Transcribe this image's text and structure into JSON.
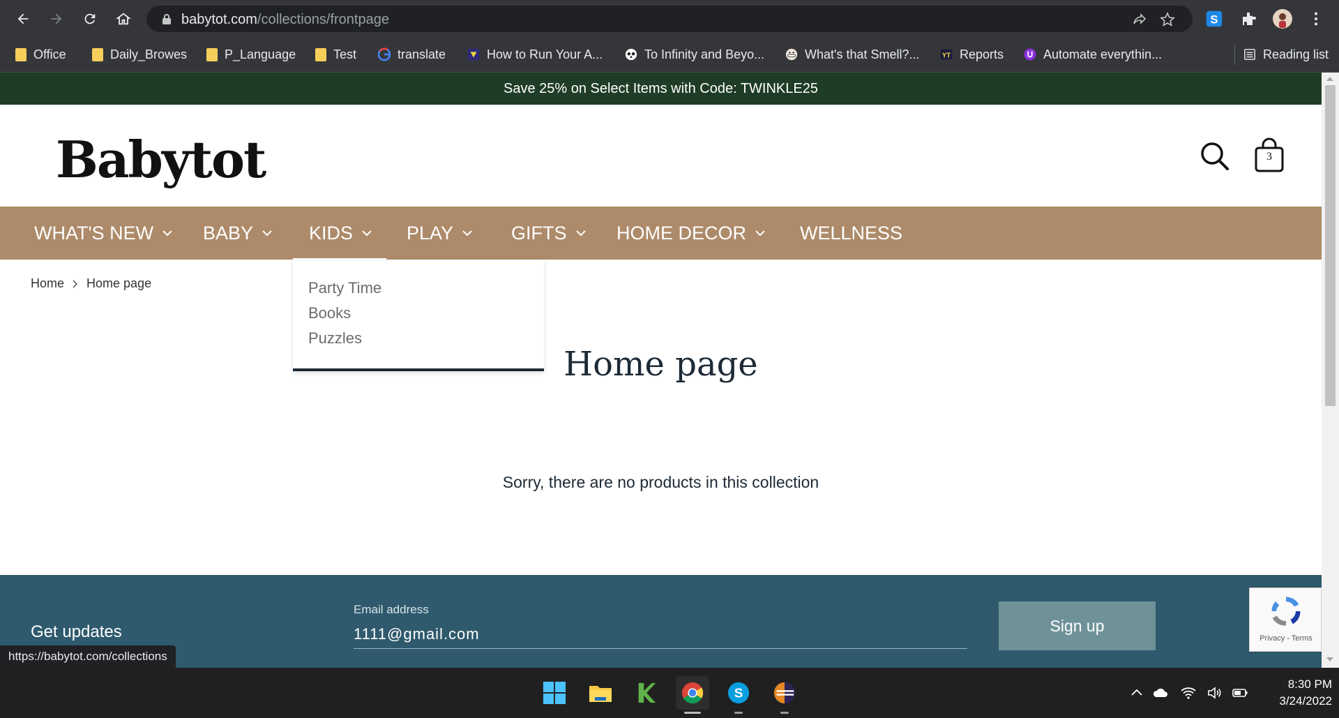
{
  "browser": {
    "url_domain": "babytot.com",
    "url_path": "/collections/frontpage",
    "bookmarks": [
      {
        "label": "Office",
        "icon": "folder-icon"
      },
      {
        "label": "Daily_Browes",
        "icon": "folder-icon"
      },
      {
        "label": "P_Language",
        "icon": "folder-icon"
      },
      {
        "label": "Test",
        "icon": "folder-icon"
      },
      {
        "label": "translate",
        "icon": "google-icon"
      },
      {
        "label": "How to Run Your A...",
        "icon": "site-icon"
      },
      {
        "label": "To Infinity and Beyo...",
        "icon": "panda-icon"
      },
      {
        "label": "What's that Smell?...",
        "icon": "face-icon"
      },
      {
        "label": "Reports",
        "icon": "reports-icon"
      },
      {
        "label": "Automate everythin...",
        "icon": "automate-icon"
      }
    ],
    "reading_list_label": "Reading list",
    "status_url": "https://babytot.com/collections"
  },
  "site": {
    "promo": "Save 25% on Select Items with Code: TWINKLE25",
    "logo": "Babytot",
    "cart_count": "3",
    "nav": [
      {
        "label": "WHAT'S NEW"
      },
      {
        "label": "BABY"
      },
      {
        "label": "KIDS"
      },
      {
        "label": "PLAY"
      },
      {
        "label": "GIFTS"
      },
      {
        "label": "HOME DECOR"
      },
      {
        "label": "WELLNESS"
      }
    ],
    "kids_dropdown": [
      "Party Time",
      "Books",
      "Puzzles"
    ],
    "breadcrumb": {
      "home": "Home",
      "current": "Home page"
    },
    "page_title": "Home page",
    "empty_message": "Sorry, there are no products in this collection",
    "footer": {
      "get_updates": "Get updates",
      "email_label": "Email address",
      "email_value": "1111@gmail.com",
      "signup": "Sign up",
      "recaptcha_text": "Privacy - Terms"
    }
  },
  "taskbar": {
    "time": "8:30 PM",
    "date": "3/24/2022"
  },
  "colors": {
    "promo_bg": "#1f3d26",
    "nav_bg": "#ad8b6a",
    "footer_bg": "#2f5a6d",
    "signup_bg": "#6f9299"
  }
}
